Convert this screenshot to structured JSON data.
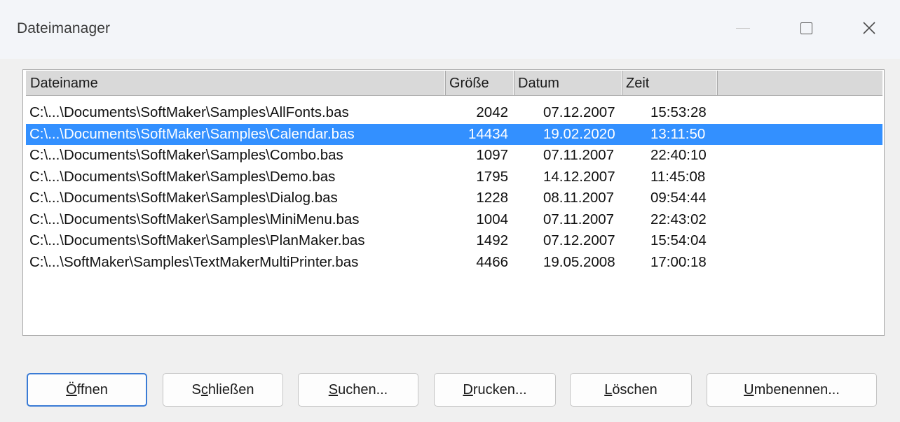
{
  "window": {
    "title": "Dateimanager"
  },
  "list": {
    "columns": [
      "Dateiname",
      "Größe",
      "Datum",
      "Zeit"
    ],
    "rows": [
      {
        "name": "C:\\...\\Documents\\SoftMaker\\Samples\\AllFonts.bas",
        "size": "2042",
        "date": "07.12.2007",
        "time": "15:53:28",
        "selected": false
      },
      {
        "name": "C:\\...\\Documents\\SoftMaker\\Samples\\Calendar.bas",
        "size": "14434",
        "date": "19.02.2020",
        "time": "13:11:50",
        "selected": true
      },
      {
        "name": "C:\\...\\Documents\\SoftMaker\\Samples\\Combo.bas",
        "size": "1097",
        "date": "07.11.2007",
        "time": "22:40:10",
        "selected": false
      },
      {
        "name": "C:\\...\\Documents\\SoftMaker\\Samples\\Demo.bas",
        "size": "1795",
        "date": "14.12.2007",
        "time": "11:45:08",
        "selected": false
      },
      {
        "name": "C:\\...\\Documents\\SoftMaker\\Samples\\Dialog.bas",
        "size": "1228",
        "date": "08.11.2007",
        "time": "09:54:44",
        "selected": false
      },
      {
        "name": "C:\\...\\Documents\\SoftMaker\\Samples\\MiniMenu.bas",
        "size": "1004",
        "date": "07.11.2007",
        "time": "22:43:02",
        "selected": false
      },
      {
        "name": "C:\\...\\Documents\\SoftMaker\\Samples\\PlanMaker.bas",
        "size": "1492",
        "date": "07.12.2007",
        "time": "15:54:04",
        "selected": false
      },
      {
        "name": "C:\\...\\SoftMaker\\Samples\\TextMakerMultiPrinter.bas",
        "size": "4466",
        "date": "19.05.2008",
        "time": "17:00:18",
        "selected": false
      }
    ]
  },
  "buttons": {
    "open": {
      "pre": "",
      "mnemonic": "Ö",
      "post": "ffnen"
    },
    "close": {
      "pre": "S",
      "mnemonic": "c",
      "post": "hließen"
    },
    "search": {
      "pre": "",
      "mnemonic": "S",
      "post": "uchen..."
    },
    "print": {
      "pre": "",
      "mnemonic": "D",
      "post": "rucken..."
    },
    "delete": {
      "pre": "",
      "mnemonic": "L",
      "post": "öschen"
    },
    "rename": {
      "pre": "",
      "mnemonic": "U",
      "post": "mbenennen..."
    }
  },
  "colors": {
    "selection": "#3390ff",
    "default_button_border": "#3a7bd5"
  }
}
